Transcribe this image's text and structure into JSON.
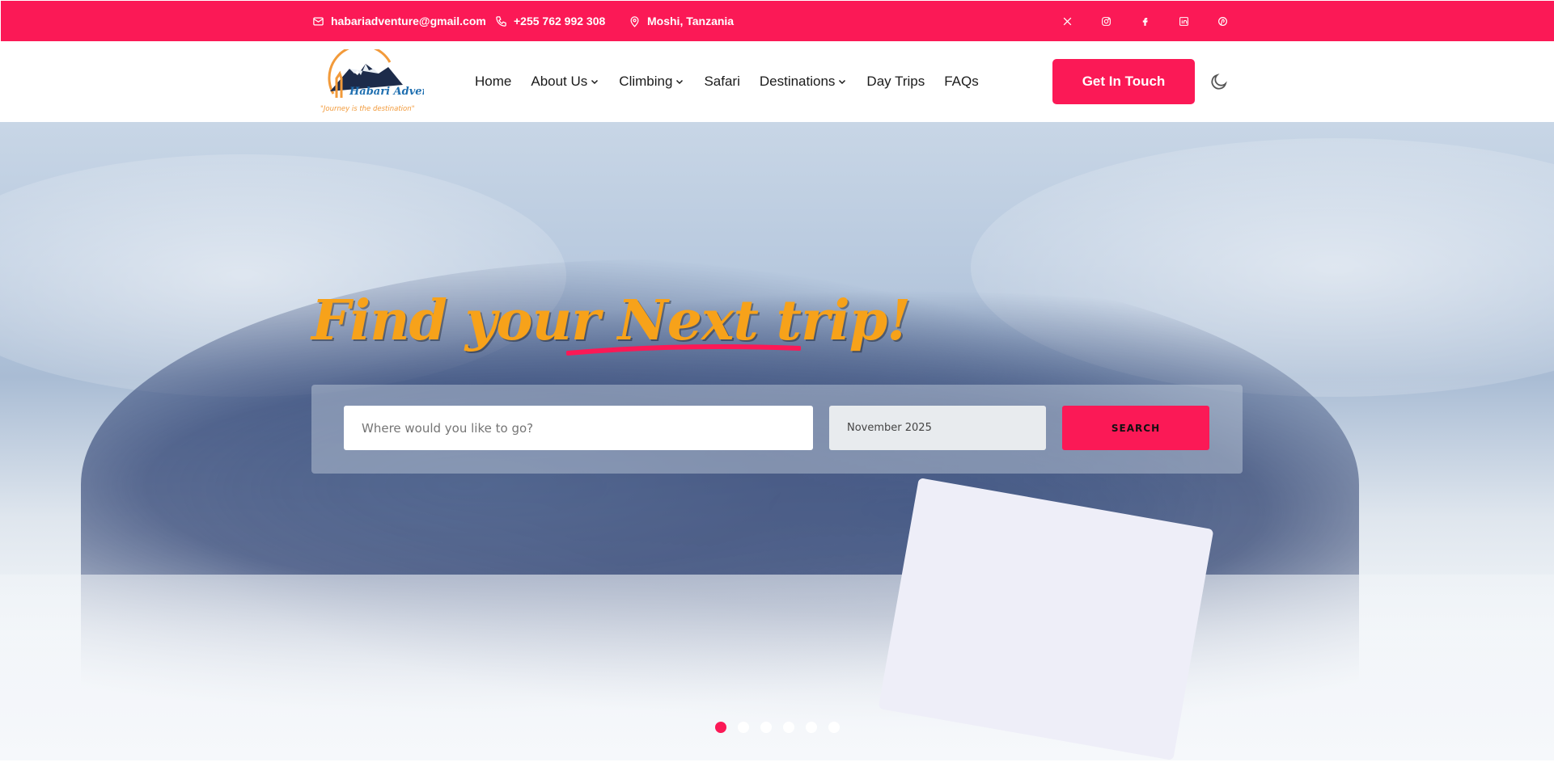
{
  "topbar": {
    "email": "habariadventure@gmail.com",
    "phone": "+255 762 992 308",
    "location": "Moshi, Tanzania",
    "socials": [
      "x-icon",
      "instagram-icon",
      "facebook-icon",
      "linkedin-icon",
      "pinterest-icon"
    ]
  },
  "logo": {
    "name": "Habari Adventure",
    "tagline": "\"Journey is the destination\""
  },
  "nav": {
    "items": [
      {
        "label": "Home",
        "dropdown": false
      },
      {
        "label": "About Us",
        "dropdown": true
      },
      {
        "label": "Climbing",
        "dropdown": true
      },
      {
        "label": "Safari",
        "dropdown": false
      },
      {
        "label": "Destinations",
        "dropdown": true
      },
      {
        "label": "Day Trips",
        "dropdown": false
      },
      {
        "label": "FAQs",
        "dropdown": false
      }
    ],
    "cta_label": "Get In Touch",
    "theme_toggle_icon": "moon-icon"
  },
  "hero": {
    "headline": "Find your Next trip!",
    "search_placeholder": "Where would you like to go?",
    "date_value": "November 2025",
    "search_button": "SEARCH",
    "slides_total": 6,
    "active_slide": 1
  },
  "colors": {
    "accent": "#fb1956",
    "headline": "#f7a21a"
  }
}
